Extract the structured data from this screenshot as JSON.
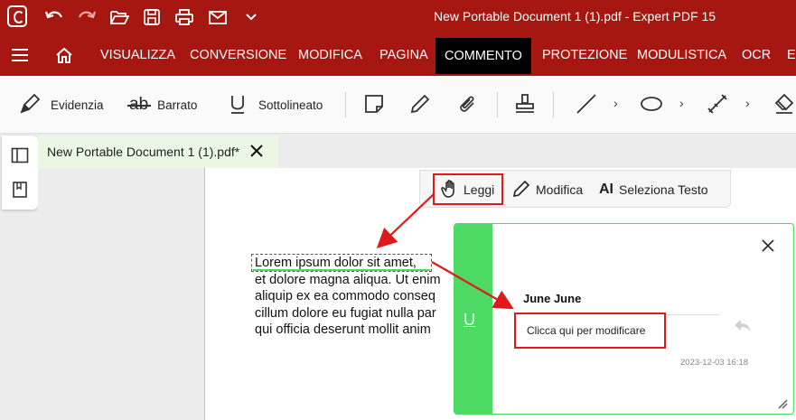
{
  "window": {
    "title": "New Portable Document 1 (1).pdf   -   Expert PDF 15"
  },
  "quick_access": [
    "app-logo",
    "undo-icon",
    "redo-icon",
    "open-folder-icon",
    "save-icon",
    "print-icon",
    "email-icon",
    "customize-chevron-icon"
  ],
  "menu": {
    "items": [
      "VISUALIZZA",
      "CONVERSIONE",
      "MODIFICA",
      "PAGINA",
      "COMMENTO",
      "PROTEZIONE",
      "MODULISTICA",
      "OCR",
      "E-"
    ],
    "active": "COMMENTO"
  },
  "toolbar": {
    "highlight": "Evidenzia",
    "strike": "Barrato",
    "underline": "Sottolineato"
  },
  "tab": {
    "title": "New Portable Document 1 (1).pdf*"
  },
  "read_bar": {
    "read": "Leggi",
    "edit": "Modifica",
    "select_text": "Seleziona Testo"
  },
  "document": {
    "lines": [
      "Lorem ipsum dolor sit amet,",
      "et dolore magna aliqua. Ut enim",
      "aliquip ex ea commodo conseq",
      "cillum dolore eu fugiat nulla par",
      "qui officia deserunt mollit anim"
    ]
  },
  "comment": {
    "strip_icon_text": "U",
    "author": "June June",
    "placeholder": "Clicca qui per modificare",
    "timestamp": "2023-12-03 16:18"
  },
  "colors": {
    "brand": "#a71711",
    "accent_green": "#4cd964",
    "annotation_red": "#e0191b"
  }
}
